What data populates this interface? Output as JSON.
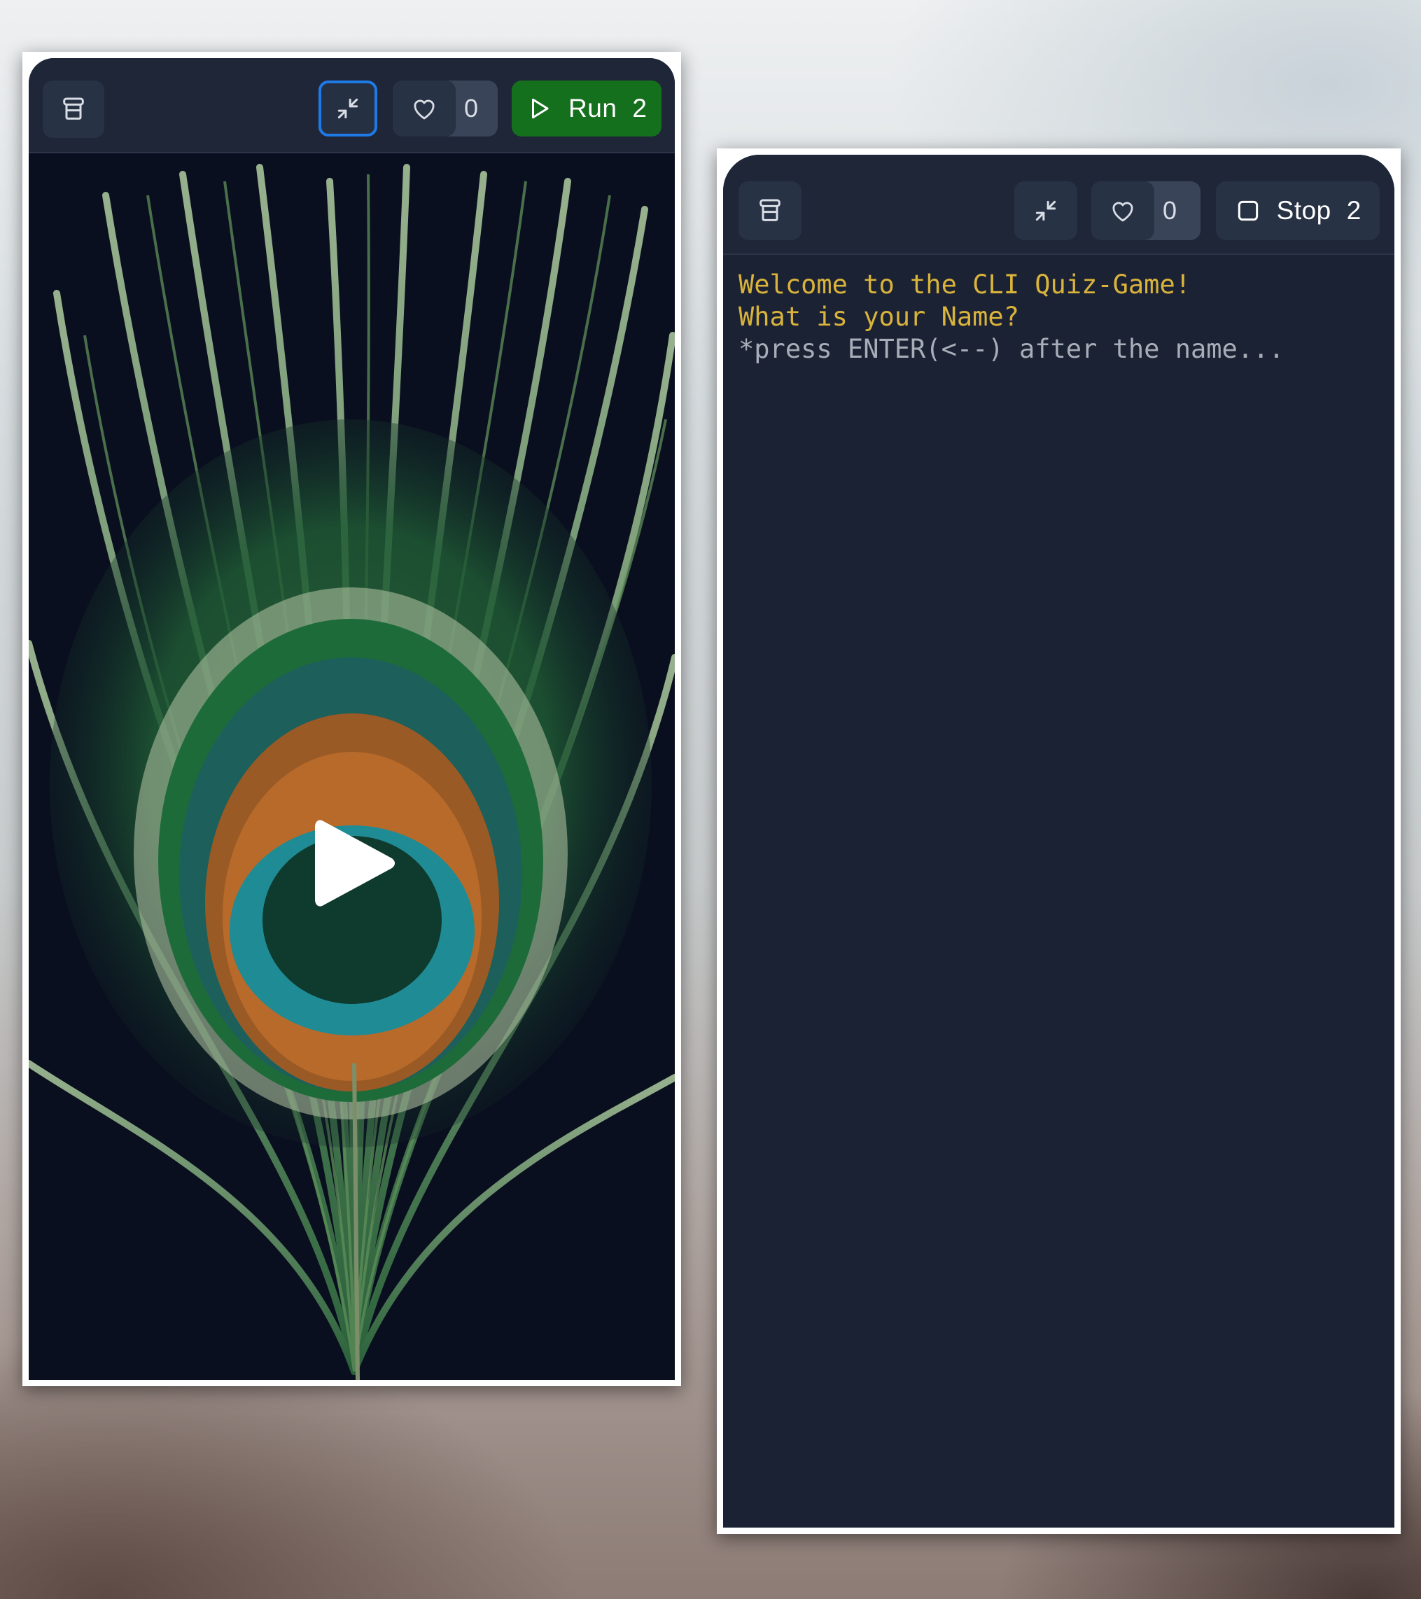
{
  "left_panel": {
    "toolbar": {
      "menu_icon": "database-stack-icon",
      "minimize_icon": "minimize-arrows-icon",
      "like_icon": "heart-icon",
      "like_count": "0",
      "run_icon": "play-outline-icon",
      "run_label": "Run",
      "run_count": "2",
      "accent_color": "#1f7ae8",
      "run_color": "#15701d"
    },
    "preview": {
      "image": "peacock-feather",
      "play_icon": "play-icon"
    }
  },
  "right_panel": {
    "toolbar": {
      "menu_icon": "database-stack-icon",
      "minimize_icon": "minimize-arrows-icon",
      "like_icon": "heart-icon",
      "like_count": "0",
      "stop_icon": "stop-square-icon",
      "stop_label": "Stop",
      "stop_count": "2"
    },
    "terminal": {
      "lines": [
        "Welcome to the CLI Quiz-Game!",
        "What is your Name?",
        "*press ENTER(<--) after the name..."
      ],
      "colors": {
        "prompt": "#d9b33b",
        "hint": "#a8adb8",
        "background": "#1b2233"
      }
    }
  }
}
